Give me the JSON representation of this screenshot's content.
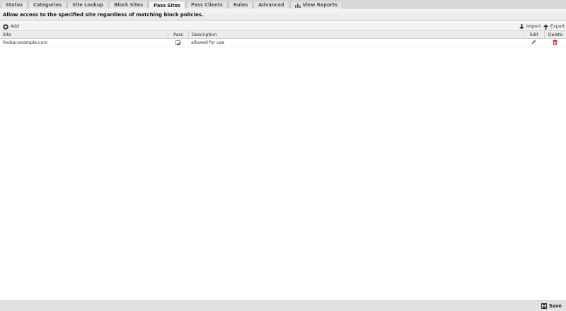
{
  "tabs": [
    {
      "label": "Status",
      "active": false
    },
    {
      "label": "Categories",
      "active": false
    },
    {
      "label": "Site Lookup",
      "active": false
    },
    {
      "label": "Block Sites",
      "active": false
    },
    {
      "label": "Pass Sites",
      "active": true
    },
    {
      "label": "Pass Clients",
      "active": false
    },
    {
      "label": "Rules",
      "active": false
    },
    {
      "label": "Advanced",
      "active": false
    },
    {
      "label": "View Reports",
      "active": false,
      "icon": "chart-icon"
    }
  ],
  "description": "Allow access to the specified site regardless of matching block policies.",
  "toolbar": {
    "add_label": "Add",
    "import_label": "Import",
    "export_label": "Export"
  },
  "grid": {
    "columns": {
      "site": "Site",
      "pass": "Pass",
      "description": "Description",
      "edit": "Edit",
      "delete": "Delete"
    },
    "rows": [
      {
        "site": "foobar.example.com",
        "pass": true,
        "description": "allowed for use"
      }
    ]
  },
  "footer": {
    "save_label": "Save"
  },
  "colors": {
    "delete_icon": "#cc2222",
    "checkbox_border": "#8d8db0"
  }
}
